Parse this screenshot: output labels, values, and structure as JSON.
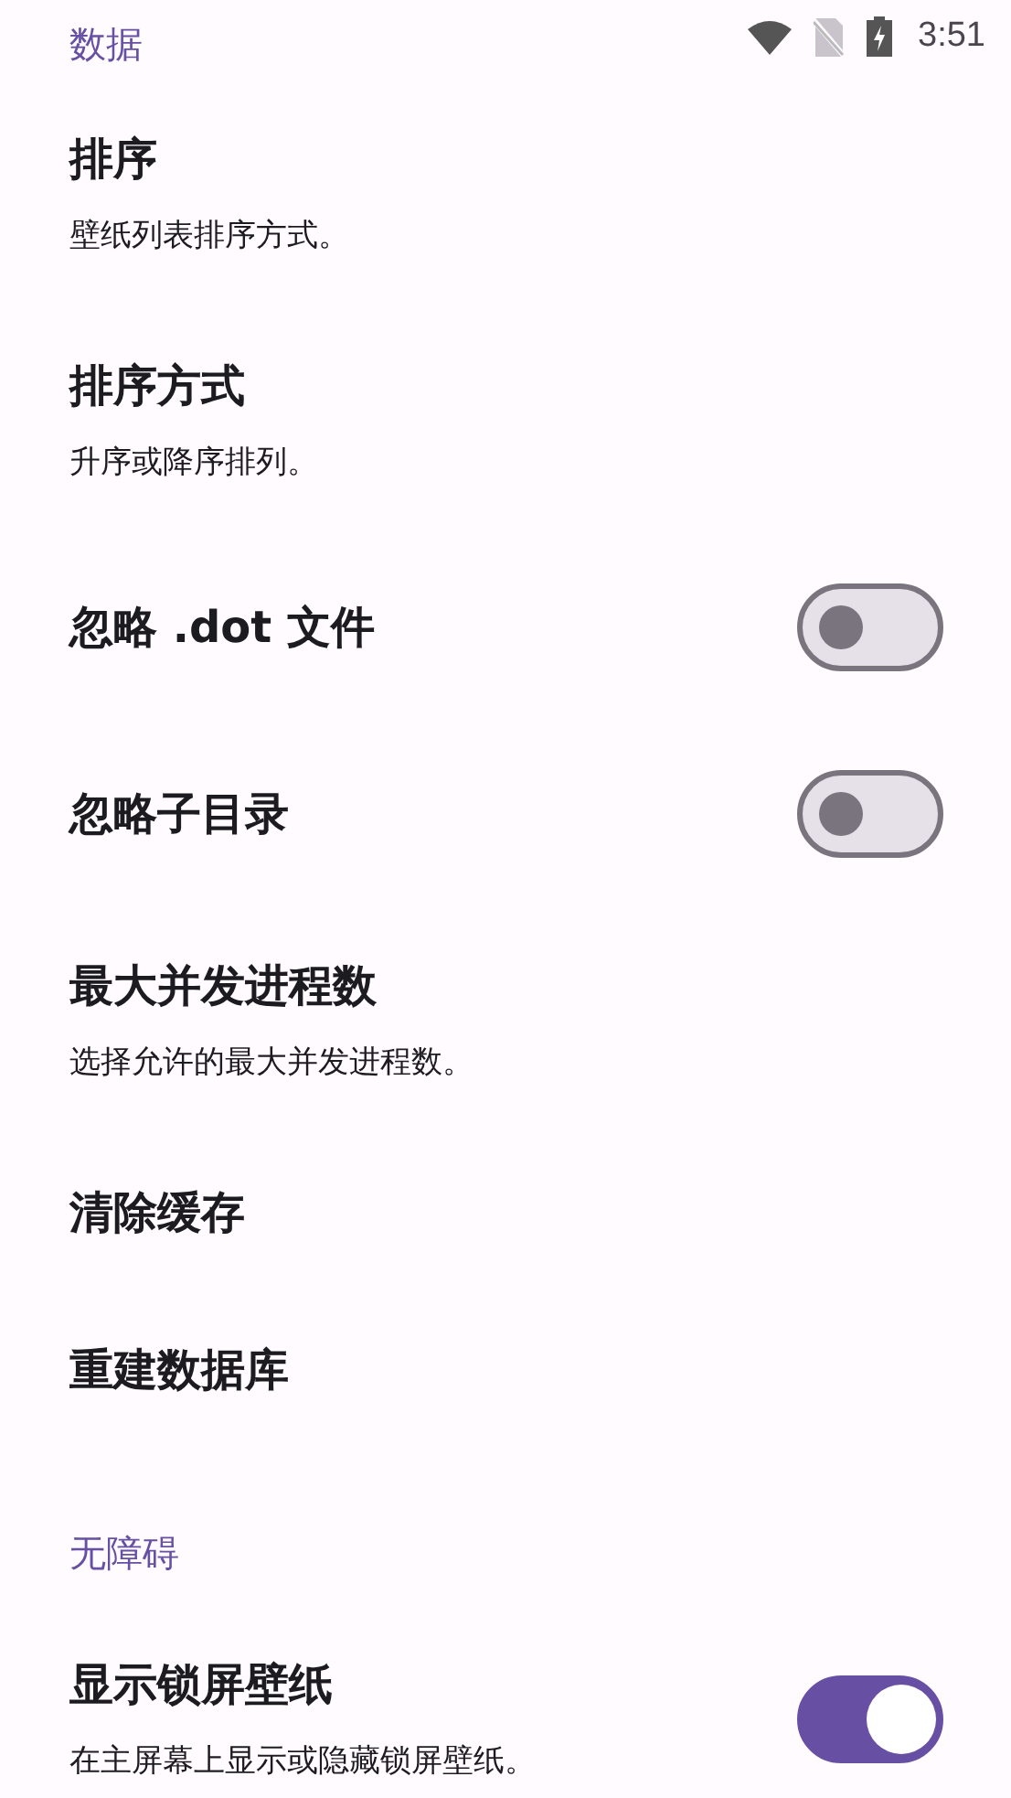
{
  "status_bar": {
    "time": "3:51"
  },
  "sections": [
    {
      "title": "数据",
      "items": [
        {
          "kind": "plain",
          "title": "排序",
          "subtitle": "壁纸列表排序方式。"
        },
        {
          "kind": "plain",
          "title": "排序方式",
          "subtitle": "升序或降序排列。"
        },
        {
          "kind": "switch",
          "title": "忽略 .dot 文件",
          "on": false
        },
        {
          "kind": "switch",
          "title": "忽略子目录",
          "on": false
        },
        {
          "kind": "plain",
          "title": "最大并发进程数",
          "subtitle": "选择允许的最大并发进程数。"
        },
        {
          "kind": "plain",
          "title": "清除缓存"
        },
        {
          "kind": "plain",
          "title": "重建数据库"
        }
      ]
    },
    {
      "title": "无障碍",
      "items": [
        {
          "kind": "switch",
          "title": "显示锁屏壁纸",
          "subtitle": "在主屏幕上显示或隐藏锁屏壁纸。",
          "on": true
        }
      ]
    }
  ]
}
